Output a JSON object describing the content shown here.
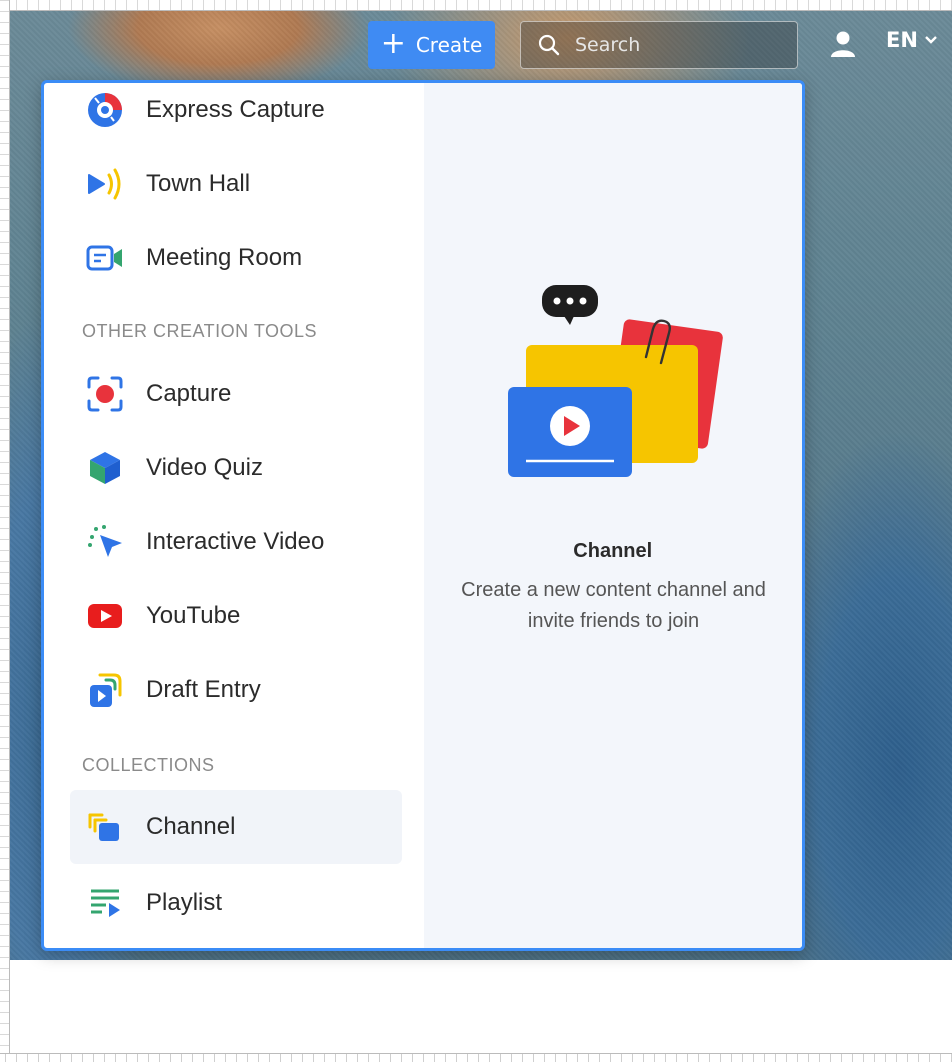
{
  "header": {
    "create_label": "Create",
    "search_placeholder": "Search",
    "language": "EN"
  },
  "menu": {
    "top_items": [
      {
        "label": "Express Capture",
        "icon": "express-capture-icon"
      },
      {
        "label": "Town Hall",
        "icon": "town-hall-icon"
      },
      {
        "label": "Meeting Room",
        "icon": "meeting-room-icon"
      }
    ],
    "other_tools_heading": "OTHER CREATION TOOLS",
    "other_tools": [
      {
        "label": "Capture",
        "icon": "capture-icon"
      },
      {
        "label": "Video Quiz",
        "icon": "video-quiz-icon"
      },
      {
        "label": "Interactive Video",
        "icon": "interactive-video-icon"
      },
      {
        "label": "YouTube",
        "icon": "youtube-icon"
      },
      {
        "label": "Draft Entry",
        "icon": "draft-entry-icon"
      }
    ],
    "collections_heading": "COLLECTIONS",
    "collections": [
      {
        "label": "Channel",
        "icon": "channel-icon",
        "active": true
      },
      {
        "label": "Playlist",
        "icon": "playlist-icon"
      }
    ]
  },
  "preview": {
    "title": "Channel",
    "description": "Create a new content channel and invite friends to join"
  },
  "colors": {
    "accent": "#3b8cf6",
    "red": "#e8333c",
    "yellow": "#f6c500",
    "blue": "#2f74e6",
    "green": "#34a56f"
  }
}
